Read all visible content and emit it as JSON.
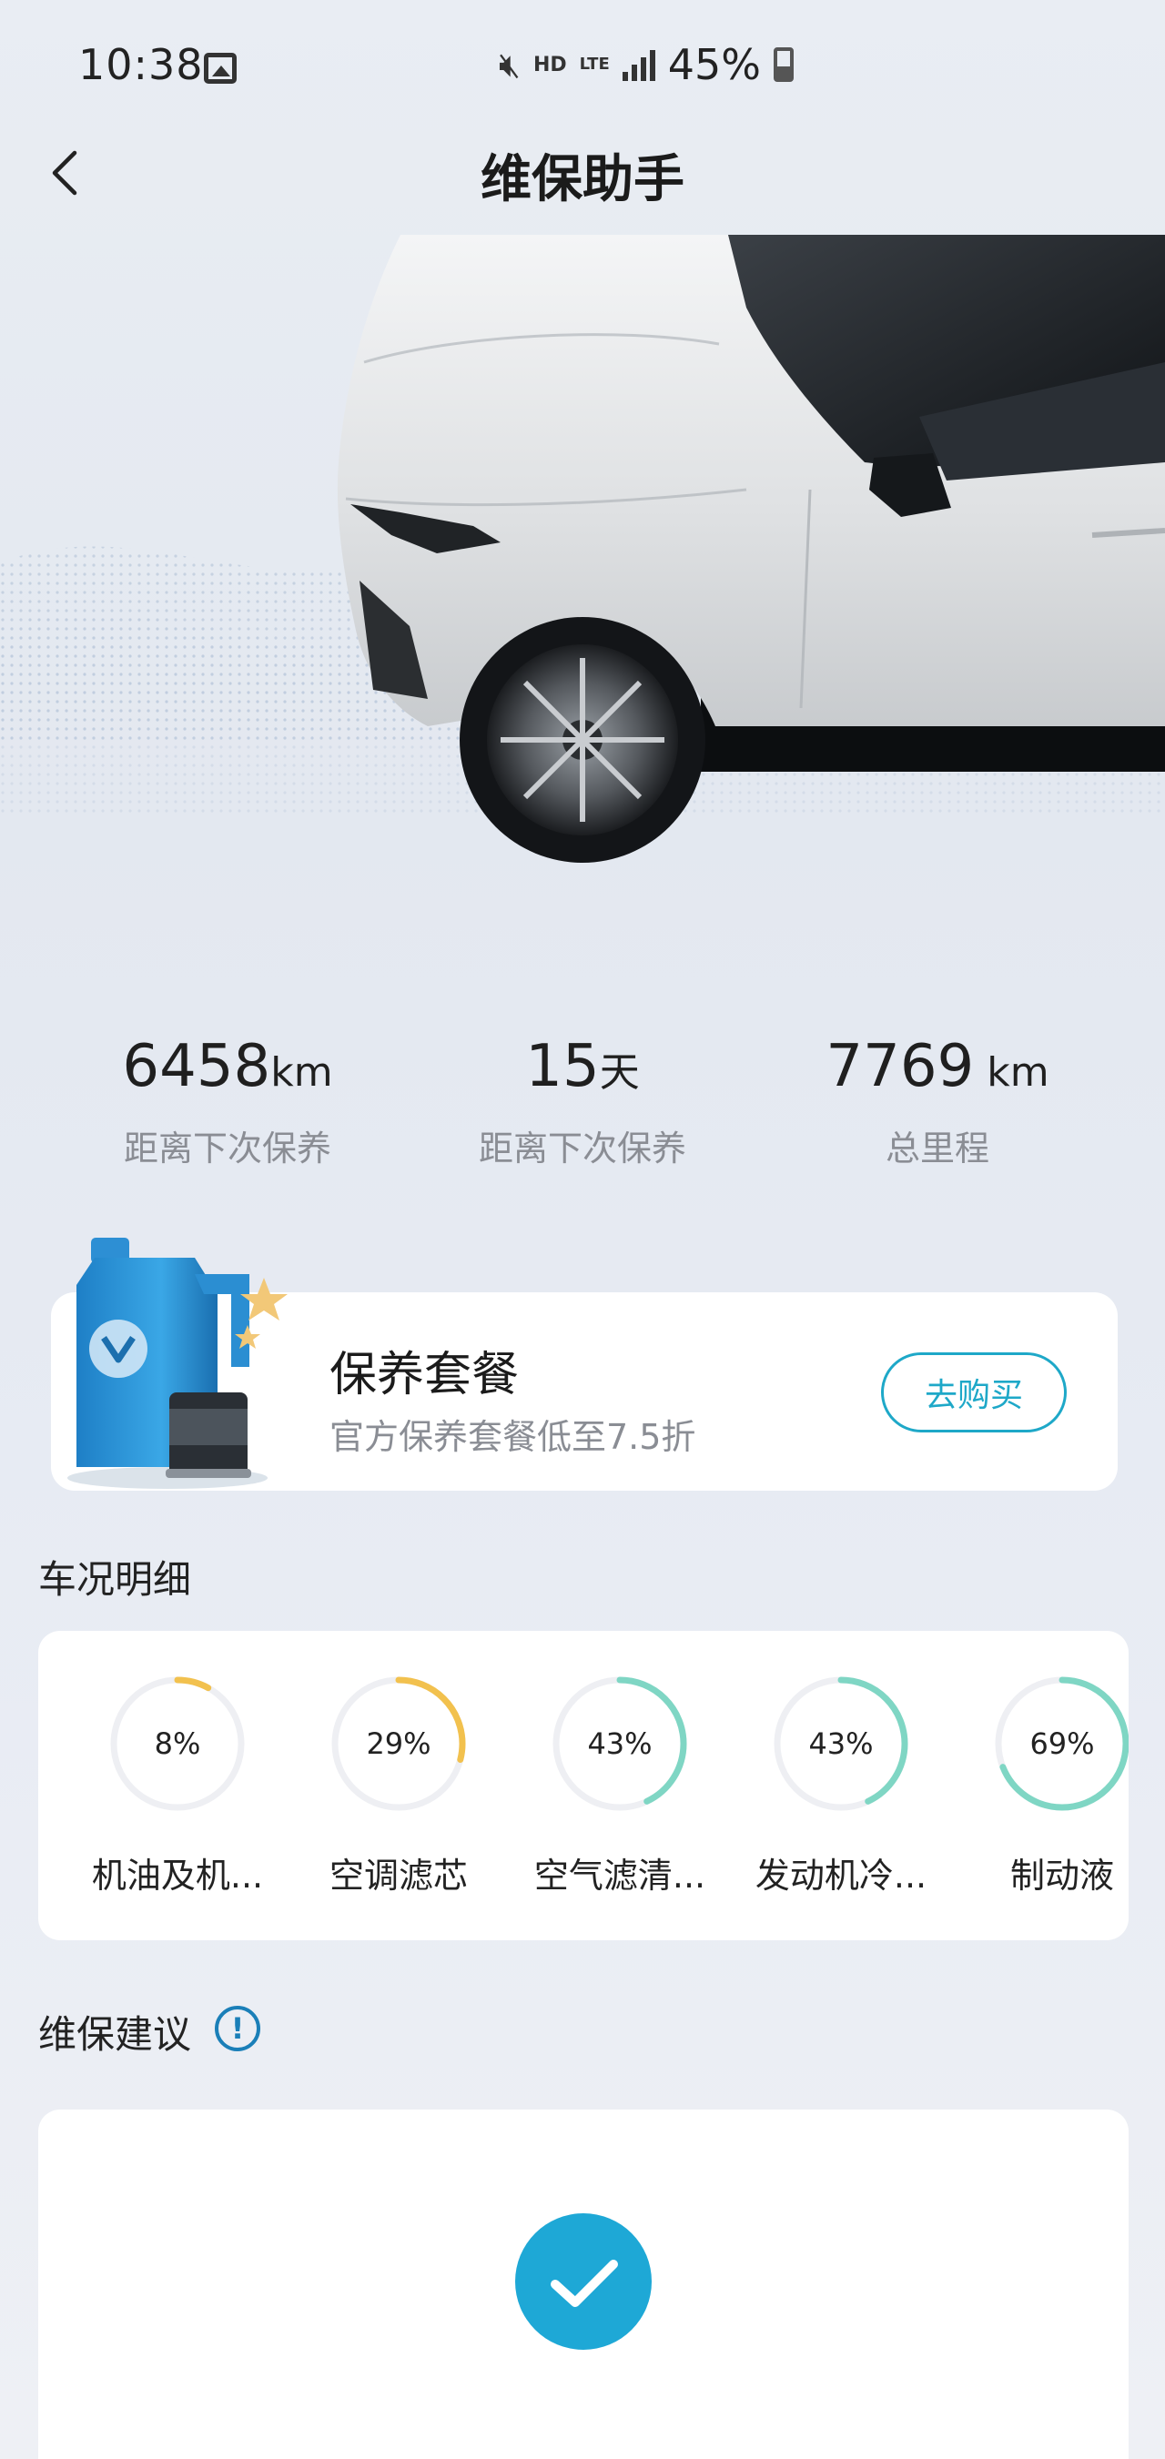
{
  "status_bar": {
    "time": "10:38",
    "hd": "HD",
    "lte": "LTE",
    "battery": "45%"
  },
  "header": {
    "title": "维保助手"
  },
  "stats": [
    {
      "value": "6458",
      "unit": "km",
      "label": "距离下次保养"
    },
    {
      "value": "15",
      "unit": "天",
      "label": "距离下次保养"
    },
    {
      "value": "7769",
      "unit": " km",
      "label": "总里程"
    }
  ],
  "package": {
    "title": "保养套餐",
    "subtitle": "官方保养套餐低至7.5折",
    "button": "去购买"
  },
  "condition": {
    "title": "车况明细",
    "items": [
      {
        "pct_text": "8%",
        "pct": 8,
        "label": "机油及机...",
        "color": "#f2c14e"
      },
      {
        "pct_text": "29%",
        "pct": 29,
        "label": "空调滤芯",
        "color": "#f2c14e"
      },
      {
        "pct_text": "43%",
        "pct": 43,
        "label": "空气滤清...",
        "color": "#7fd6c4"
      },
      {
        "pct_text": "43%",
        "pct": 43,
        "label": "发动机冷...",
        "color": "#7fd6c4"
      },
      {
        "pct_text": "69%",
        "pct": 69,
        "label": "制动液",
        "color": "#7fd6c4"
      }
    ]
  },
  "advice": {
    "title": "维保建议"
  },
  "colors": {
    "accent": "#1ea8c8",
    "check": "#1ea8d6",
    "info": "#1a7fb8"
  }
}
